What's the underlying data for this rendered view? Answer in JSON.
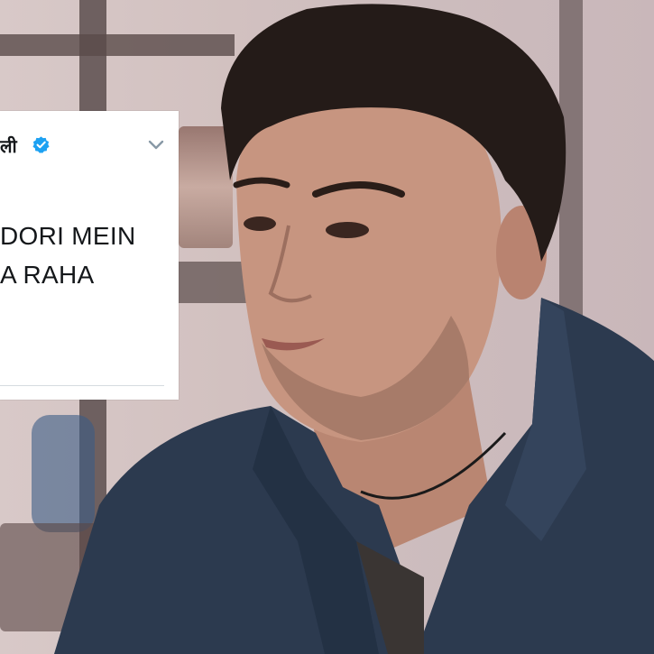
{
  "tweet": {
    "author_name": "ली",
    "line1": "DORI MEIN",
    "line2": "A RAHA",
    "verified_icon": "verified-badge-icon",
    "menu_icon": "chevron-down-icon"
  },
  "colors": {
    "verified": "#1da1f2",
    "chevron": "#8899a6",
    "text": "#14171a",
    "shirt": "#2b3a50"
  }
}
